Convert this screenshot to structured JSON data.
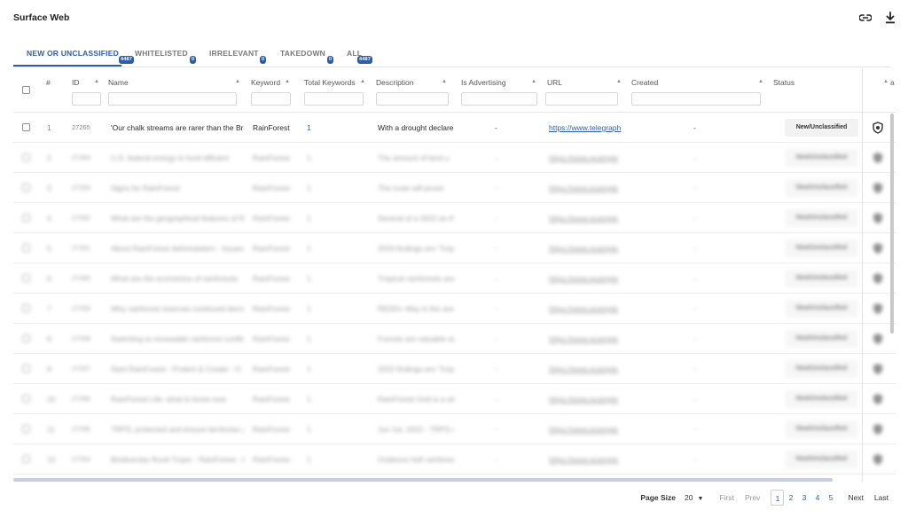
{
  "page": {
    "title": "Surface Web"
  },
  "toolbar": {
    "link_icon": "link-icon",
    "download_icon": "download-icon"
  },
  "tabs": [
    {
      "label": "NEW OR UNCLASSIFIED",
      "count": "4487"
    },
    {
      "label": "WHITELISTED",
      "count": "0"
    },
    {
      "label": "IRRELEVANT",
      "count": "0"
    },
    {
      "label": "TAKEDOWN",
      "count": "0"
    },
    {
      "label": "ALL",
      "count": "4487"
    }
  ],
  "columns": {
    "num": "#",
    "id": "ID",
    "name": "Name",
    "keyword": "Keyword",
    "total_keywords": "Total Keywords",
    "description": "Description",
    "is_advertising": "Is Advertising",
    "url": "URL",
    "created": "Created",
    "status": "Status",
    "actions": "a"
  },
  "rows": [
    {
      "num": "1",
      "id": "27265",
      "name": "'Our chalk streams are rarer than the Bra",
      "keyword": "RainForest",
      "total_keywords": "1",
      "description": "With a drought declare",
      "is_advertising": "-",
      "url": "https://www.telegraph",
      "created": "-",
      "status": "New/Unclassified",
      "action_icon": "shield-icon"
    }
  ],
  "blurred_rows": [
    {
      "num": "2",
      "id": "27264",
      "name": "U.S. federal energy to fund efficient",
      "keyword": "RainForest",
      "total_keywords": "1",
      "description": "The amount of land u",
      "is_advertising": "-",
      "url": "https://www.example",
      "created": "-",
      "status": "New/Unclassified"
    },
    {
      "num": "3",
      "id": "27263",
      "name": "Signs for RainForest",
      "keyword": "RainForest",
      "total_keywords": "1",
      "description": "The route will prove",
      "is_advertising": "-",
      "url": "https://www.example",
      "created": "-",
      "status": "New/Unclassified"
    },
    {
      "num": "4",
      "id": "27262",
      "name": "What are the geographical features of R",
      "keyword": "RainForest",
      "total_keywords": "1",
      "description": "Several of a 2022 as the",
      "is_advertising": "-",
      "url": "https://www.example",
      "created": "-",
      "status": "New/Unclassified"
    },
    {
      "num": "5",
      "id": "27261",
      "name": "About RainForest deforestation - Issues",
      "keyword": "RainForest",
      "total_keywords": "1",
      "description": "2023 findings are 'Tropical",
      "is_advertising": "-",
      "url": "https://www.example",
      "created": "-",
      "status": "New/Unclassified"
    },
    {
      "num": "6",
      "id": "27260",
      "name": "What are the economics of rainforests",
      "keyword": "RainForest",
      "total_keywords": "1",
      "description": "Tropical rainforests are",
      "is_advertising": "-",
      "url": "https://www.example",
      "created": "-",
      "status": "New/Unclassified"
    },
    {
      "num": "7",
      "id": "27259",
      "name": "Why rainforest reserves continued decrease",
      "keyword": "RainForest",
      "total_keywords": "1",
      "description": "REDD+ May in the ares",
      "is_advertising": "-",
      "url": "https://www.example",
      "created": "-",
      "status": "New/Unclassified"
    },
    {
      "num": "8",
      "id": "27258",
      "name": "Switching to renewable rainforest conflict",
      "keyword": "RainForest",
      "total_keywords": "1",
      "description": "Forests are valuable are",
      "is_advertising": "-",
      "url": "https://www.example",
      "created": "-",
      "status": "New/Unclassified"
    },
    {
      "num": "9",
      "id": "27257",
      "name": "Start RainForest - Protect & Create - O",
      "keyword": "RainForest",
      "total_keywords": "1",
      "description": "2022 findings are 'Tropical",
      "is_advertising": "-",
      "url": "https://www.example",
      "created": "-",
      "status": "New/Unclassified"
    },
    {
      "num": "10",
      "id": "27256",
      "name": "RainForest Life: what to know now",
      "keyword": "RainForest",
      "total_keywords": "1",
      "description": "RainForest Grid is a site",
      "is_advertising": "-",
      "url": "https://www.example",
      "created": "-",
      "status": "New/Unclassified"
    },
    {
      "num": "11",
      "id": "27255",
      "name": "TRPS; protected and ensure territories are",
      "keyword": "RainForest",
      "total_keywords": "1",
      "description": "Jun 1st, 2022 - TRPS are",
      "is_advertising": "-",
      "url": "https://www.example",
      "created": "-",
      "status": "New/Unclassified"
    },
    {
      "num": "12",
      "id": "27254",
      "name": "Biodiversity Rural Tropic - RainForest - E",
      "keyword": "RainForest",
      "total_keywords": "1",
      "description": "Outdoors half rainforest",
      "is_advertising": "-",
      "url": "https://www.example",
      "created": "-",
      "status": "New/Unclassified"
    }
  ],
  "pagination": {
    "page_size_label": "Page Size",
    "page_size": "20",
    "first": "First",
    "prev": "Prev",
    "pages": [
      "1",
      "2",
      "3",
      "4",
      "5"
    ],
    "next": "Next",
    "last": "Last"
  },
  "colors": {
    "accent": "#2f5ea8",
    "status_bg": "#f2f2f2"
  }
}
